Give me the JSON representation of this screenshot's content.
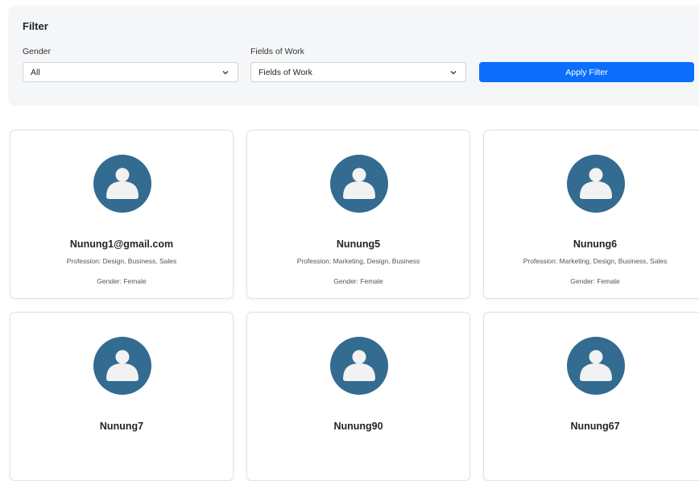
{
  "filter": {
    "title": "Filter",
    "gender_label": "Gender",
    "gender_value": "All",
    "work_label": "Fields of Work",
    "work_value": "Fields of Work",
    "apply_label": "Apply Filter"
  },
  "colors": {
    "accent": "#0d6efd",
    "avatar_bg": "#336b91",
    "avatar_fg": "#f2f2f2"
  },
  "profiles": [
    {
      "name": "Nunung1@gmail.com",
      "profession": "Profession: Design, Business, Sales",
      "gender": "Gender: Female"
    },
    {
      "name": "Nunung5",
      "profession": "Profession: Marketing, Design, Business",
      "gender": "Gender: Female"
    },
    {
      "name": "Nunung6",
      "profession": "Profession: Marketing, Design, Business, Sales",
      "gender": "Gender: Female"
    },
    {
      "name": "Nunung7"
    },
    {
      "name": "Nunung90"
    },
    {
      "name": "Nunung67"
    }
  ]
}
